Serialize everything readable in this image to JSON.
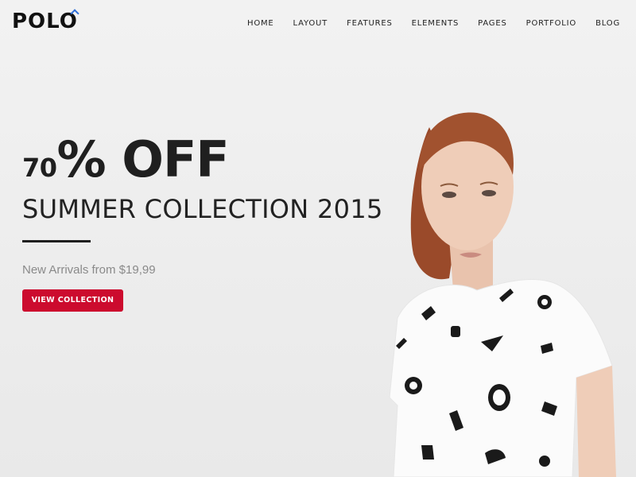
{
  "brand": {
    "name": "POLO"
  },
  "nav": {
    "items": [
      {
        "label": "HOME"
      },
      {
        "label": "LAYOUT"
      },
      {
        "label": "FEATURES"
      },
      {
        "label": "ELEMENTS"
      },
      {
        "label": "PAGES"
      },
      {
        "label": "PORTFOLIO"
      },
      {
        "label": "BLOG"
      }
    ]
  },
  "hero": {
    "promo_number": "70",
    "promo_text": "% OFF",
    "title": "SUMMER COLLECTION 2015",
    "subtitle": "New Arrivals from $19,99",
    "cta_label": "VIEW COLLECTION"
  },
  "colors": {
    "accent": "#cc0b2e",
    "logo_mark": "#2f6fd8",
    "text_dark": "#1f1f1f"
  }
}
